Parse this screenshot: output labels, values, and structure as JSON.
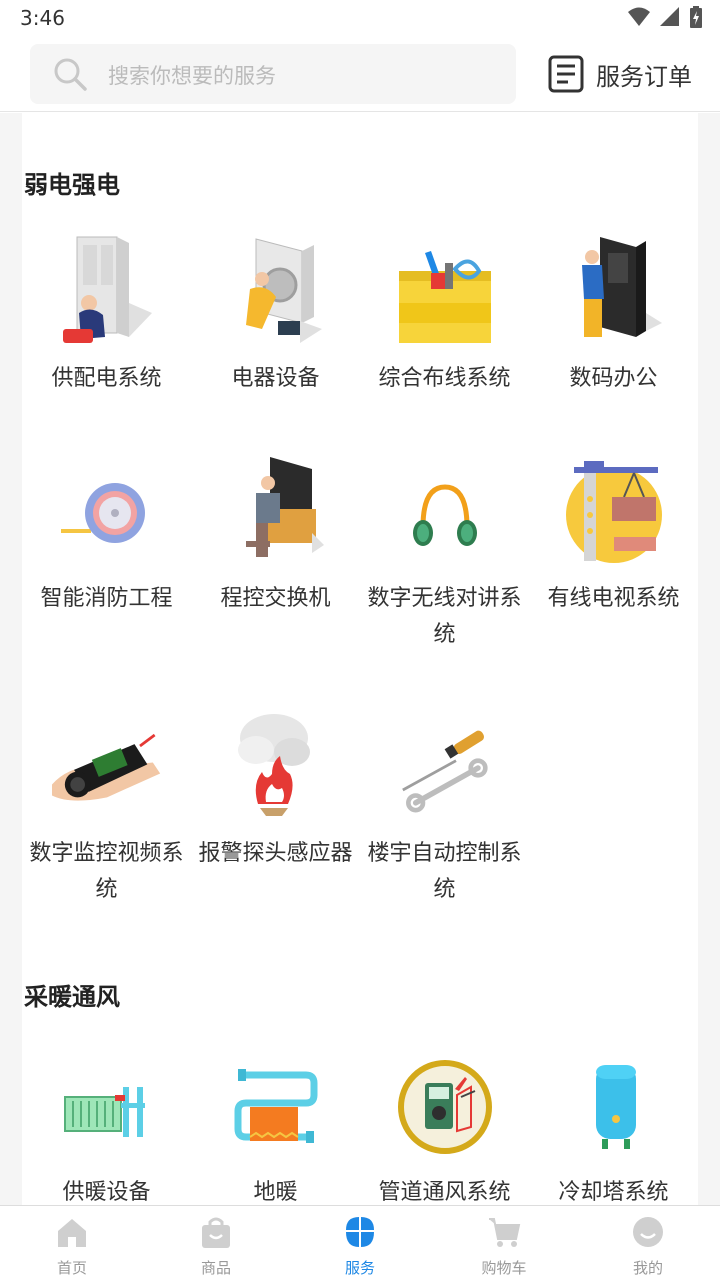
{
  "status": {
    "time": "3:46"
  },
  "search": {
    "placeholder": "搜索你想要的服务"
  },
  "header": {
    "order_label": "服务订单"
  },
  "sections": [
    {
      "title": "弱电强电",
      "items": [
        {
          "label": "供配电系统",
          "icon": "power-distribution-icon"
        },
        {
          "label": "电器设备",
          "icon": "electrical-equipment-icon"
        },
        {
          "label": "综合布线系统",
          "icon": "cabling-toolbox-icon"
        },
        {
          "label": "数码办公",
          "icon": "digital-office-icon"
        },
        {
          "label": "智能消防工程",
          "icon": "tape-measure-icon"
        },
        {
          "label": "程控交换机",
          "icon": "switchboard-icon"
        },
        {
          "label": "数字无线对讲系统",
          "icon": "headphones-icon"
        },
        {
          "label": "有线电视系统",
          "icon": "cable-tv-icon"
        },
        {
          "label": "数字监控视频系统",
          "icon": "surveillance-camera-icon"
        },
        {
          "label": "报警探头感应器",
          "icon": "fire-alarm-icon"
        },
        {
          "label": "楼宇自动控制系统",
          "icon": "wrench-screwdriver-icon"
        }
      ]
    },
    {
      "title": "采暖通风",
      "items": [
        {
          "label": "供暖设备",
          "icon": "radiator-icon"
        },
        {
          "label": "地暖",
          "icon": "floor-heating-icon"
        },
        {
          "label": "管道通风系统",
          "icon": "multimeter-icon"
        },
        {
          "label": "冷却塔系统",
          "icon": "water-heater-icon"
        }
      ]
    }
  ],
  "nav": [
    {
      "label": "首页",
      "icon": "home-icon",
      "active": false
    },
    {
      "label": "商品",
      "icon": "bag-icon",
      "active": false
    },
    {
      "label": "服务",
      "icon": "service-grid-icon",
      "active": true
    },
    {
      "label": "购物车",
      "icon": "cart-icon",
      "active": false
    },
    {
      "label": "我的",
      "icon": "profile-icon",
      "active": false
    }
  ],
  "colors": {
    "accent": "#1e88e5",
    "inactive_nav": "#999999",
    "background": "#f5f5f5"
  }
}
